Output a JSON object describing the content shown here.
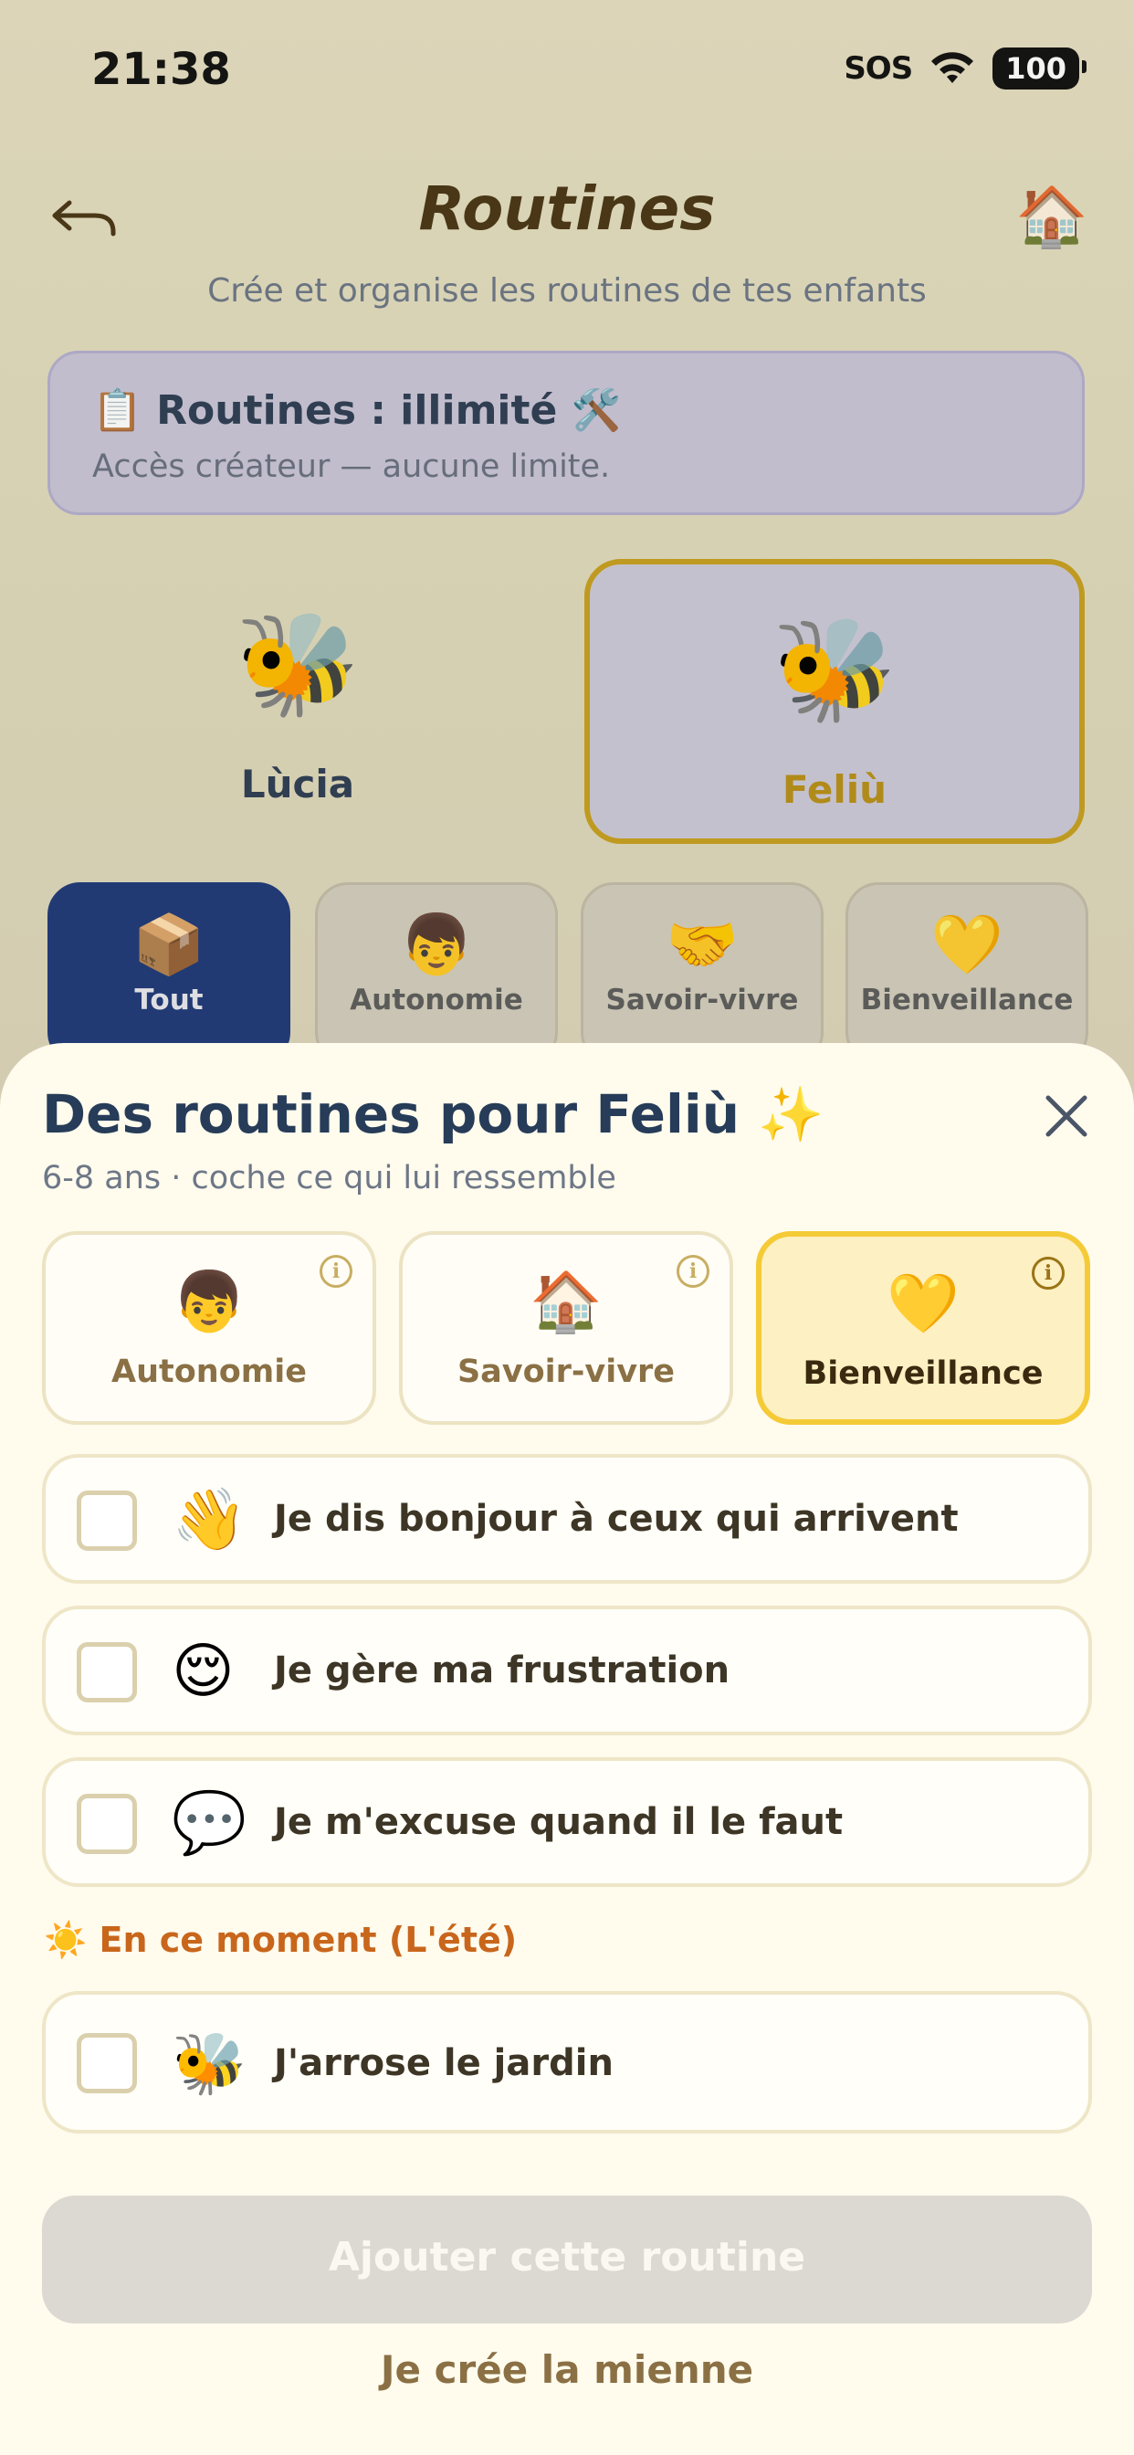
{
  "status_bar": {
    "time": "21:38",
    "sos": "SOS",
    "battery": "100"
  },
  "header": {
    "title": "Routines",
    "subtitle": "Crée et organise les routines de tes enfants",
    "home_icon": "🏠"
  },
  "info_card": {
    "title": "📋 Routines : illimité 🛠️",
    "subtitle": "Accès créateur — aucune limite."
  },
  "children": [
    {
      "name": "Lùcia",
      "avatar": "🐝"
    },
    {
      "name": "Feliù",
      "avatar": "🐝"
    }
  ],
  "categories": [
    {
      "label": "Tout",
      "icon": "📦"
    },
    {
      "label": "Autonomie",
      "icon": "👦"
    },
    {
      "label": "Savoir-vivre",
      "icon": "🤝"
    },
    {
      "label": "Bienveillance",
      "icon": "💛"
    }
  ],
  "sheet": {
    "title": "Des routines pour Feliù ✨",
    "subtitle": "6-8 ans · coche ce qui lui ressemble",
    "tabs": [
      {
        "label": "Autonomie",
        "icon": "👦",
        "info": "i"
      },
      {
        "label": "Savoir-vivre",
        "icon": "🏠",
        "info": "i"
      },
      {
        "label": "Bienveillance",
        "icon": "💛",
        "info": "i"
      }
    ],
    "items": [
      {
        "emoji": "👋",
        "text": "Je dis bonjour à ceux qui arrivent"
      },
      {
        "emoji": "😌",
        "text": "Je gère ma frustration"
      },
      {
        "emoji": "💬",
        "text": "Je m'excuse quand il le faut"
      }
    ],
    "season_label": "☀️ En ce moment (L'été)",
    "season_items": [
      {
        "emoji": "🐝",
        "text": "J'arrose le jardin"
      }
    ],
    "add_button": "Ajouter cette routine",
    "create_link": "Je crée la mienne"
  },
  "colors": {
    "accent": "#f4cb37",
    "selected_category": "#1f3a7a",
    "title": "#263c58"
  }
}
